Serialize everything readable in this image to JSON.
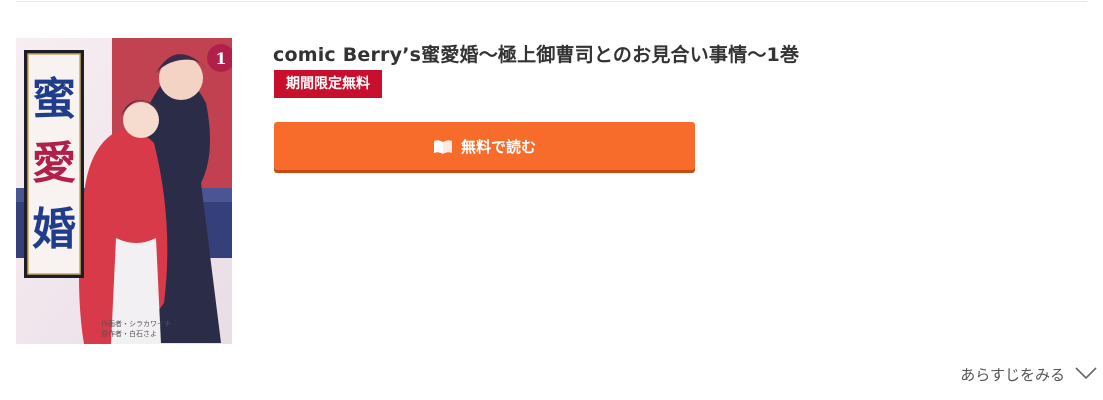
{
  "item": {
    "title": "comic Berry’s蜜愛婚～極上御曹司とのお見合い事情～1巻",
    "badge": "期間限定無料",
    "read_button_label": "無料で読む",
    "synopsis_label": "あらすじをみる"
  },
  "cover": {
    "volume": "1",
    "title_chars": [
      "蜜",
      "愛",
      "婚"
    ],
    "subtitle": "～極上御曹司とのお見合い事情～",
    "credit_artist": "作画者・シラカワイチ",
    "credit_author": "原作者・白石さよ"
  },
  "colors": {
    "badge": "#c8102e",
    "button": "#f76c2a",
    "button_shadow": "#c94a12"
  },
  "icons": {
    "read": "open-book-icon",
    "synopsis": "chevron-down-icon"
  }
}
